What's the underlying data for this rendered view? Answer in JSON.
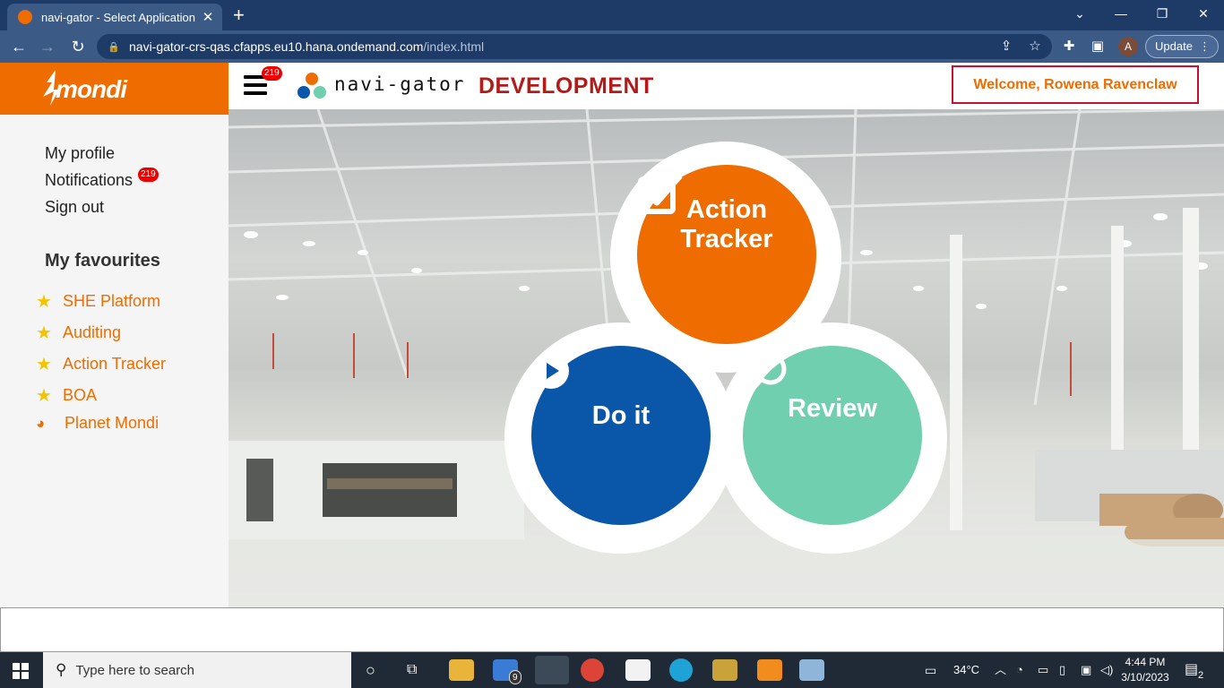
{
  "browser": {
    "tab_title": "navi-gator - Select Application",
    "tab_close": "✕",
    "new_tab": "+",
    "url_host": "navi-gator-crs-qas.cfapps.eu10.hana.ondemand.com",
    "url_path": "/index.html",
    "profile_initial": "A",
    "update_label": "Update",
    "window_controls": [
      "⌄",
      "—",
      "❐",
      "✕"
    ]
  },
  "header": {
    "logo": "mondi",
    "menu_badge": "219",
    "app_name": "navi-gator",
    "environment": "DEVELOPMENT",
    "welcome": "Welcome, Rowena Ravenclaw"
  },
  "sidebar": {
    "links": [
      "My profile",
      "Notifications",
      "Sign out"
    ],
    "notifications_badge": "219",
    "favourites_title": "My favourites",
    "favourites": [
      "SHE Platform",
      "Auditing",
      "Action Tracker",
      "BOA",
      "Planet Mondi"
    ]
  },
  "tiles": {
    "action_tracker_line1": "Action",
    "action_tracker_line2": "Tracker",
    "do_it": "Do it",
    "review": "Review"
  },
  "colors": {
    "brand_orange": "#ef6c00",
    "do_it_blue": "#0a56a8",
    "review_green": "#6fcfae",
    "dev_red": "#b31b1b"
  },
  "taskbar": {
    "search_placeholder": "Type here to search",
    "mail_badge": "9",
    "temperature": "34°C",
    "time": "4:44 PM",
    "date": "3/10/2023",
    "notification_count": "2"
  }
}
